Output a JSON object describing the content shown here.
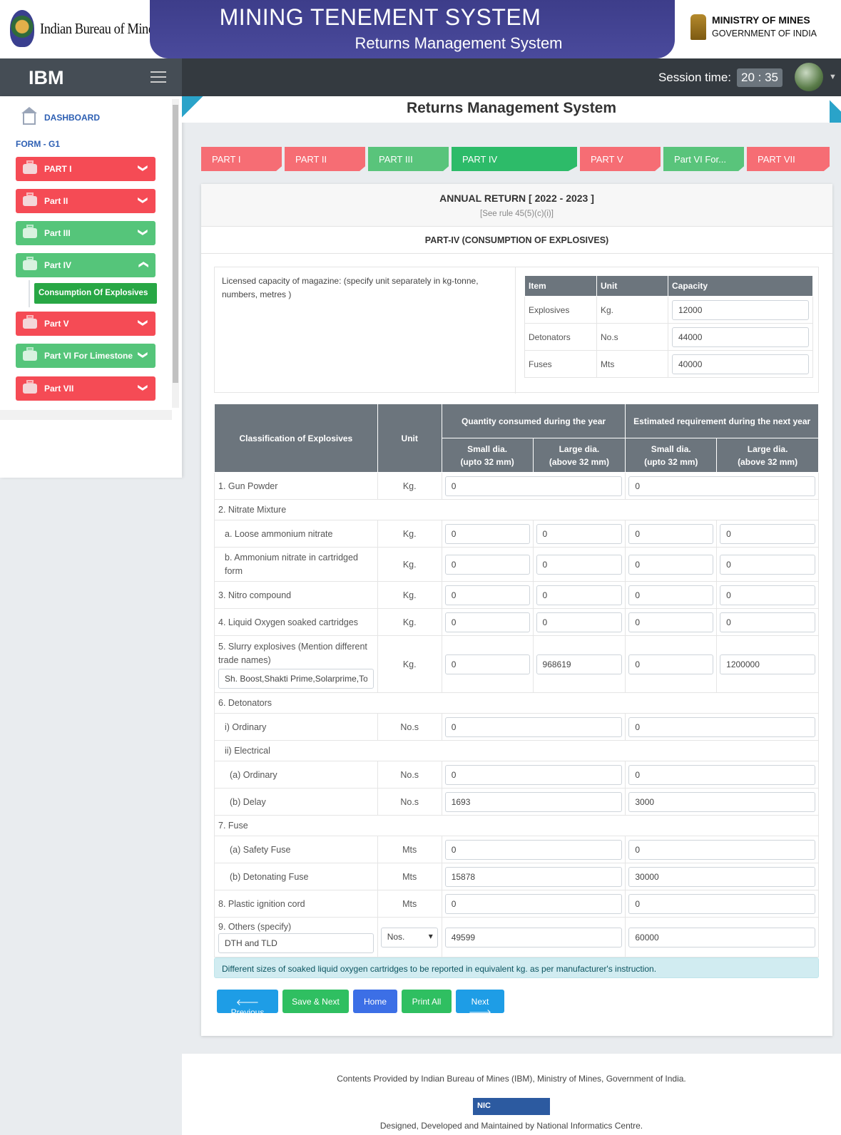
{
  "header": {
    "left_logo_text": "Indian Bureau of Mines",
    "title": "MINING TENEMENT SYSTEM",
    "subtitle": "Returns Management System",
    "ministry_line1": "MINISTRY OF MINES",
    "ministry_line2": "GOVERNMENT OF INDIA"
  },
  "navbar": {
    "brand": "IBM",
    "session_label": "Session time:",
    "session_value": "20 : 35"
  },
  "sidebar": {
    "dashboard": "DASHBOARD",
    "form_label": "FORM - G1",
    "items": [
      {
        "label": "PART I",
        "color": "#f54b55"
      },
      {
        "label": "Part II",
        "color": "#f54b55"
      },
      {
        "label": "Part III",
        "color": "#55c57a"
      },
      {
        "label": "Part IV",
        "color": "#55c57a"
      },
      {
        "label": "Part V",
        "color": "#f54b55"
      },
      {
        "label": "Part VI For Limestone",
        "color": "#55c57a"
      },
      {
        "label": "Part VII",
        "color": "#f54b55"
      }
    ],
    "sub_item": "Consumption Of Explosives"
  },
  "page_title": "Returns Management System",
  "tabs": [
    {
      "label": "PART I"
    },
    {
      "label": "PART II"
    },
    {
      "label": "PART III"
    },
    {
      "label": "PART IV"
    },
    {
      "label": "PART V"
    },
    {
      "label": "Part VI For..."
    },
    {
      "label": "PART VII"
    }
  ],
  "form": {
    "annual_return": "ANNUAL RETURN [ 2022 - 2023 ]",
    "rule": "[See rule 45(5)(c)(i)]",
    "part_title": "PART-IV (CONSUMPTION OF EXPLOSIVES)",
    "capacity_label": "Licensed capacity of magazine: (specify unit separately in kg-tonne, numbers, metres )",
    "capacity_headers": [
      "Item",
      "Unit",
      "Capacity"
    ],
    "capacity_rows": [
      {
        "item": "Explosives",
        "unit": "Kg.",
        "capacity": "12000"
      },
      {
        "item": "Detonators",
        "unit": "No.s",
        "capacity": "44000"
      },
      {
        "item": "Fuses",
        "unit": "Mts",
        "capacity": "40000"
      }
    ],
    "table_headers": {
      "classification": "Classification of Explosives",
      "unit": "Unit",
      "consumed": "Quantity consumed during the year",
      "estimated": "Estimated requirement during the next year",
      "small1": "Small dia.",
      "small2": "(upto 32 mm)",
      "large1": "Large dia.",
      "large2": "(above 32 mm)"
    },
    "rows": {
      "gun_powder": {
        "label": "1. Gun Powder",
        "unit": "Kg.",
        "consumed": "0",
        "estimated": "0"
      },
      "nitrate_mixture": "2. Nitrate Mixture",
      "loose_an": {
        "label": "a. Loose ammonium nitrate",
        "unit": "Kg.",
        "c_small": "0",
        "c_large": "0",
        "e_small": "0",
        "e_large": "0"
      },
      "an_cart": {
        "label": "b. Ammonium nitrate in cartridged form",
        "unit": "Kg.",
        "c_small": "0",
        "c_large": "0",
        "e_small": "0",
        "e_large": "0"
      },
      "nitro": {
        "label": "3. Nitro compound",
        "unit": "Kg.",
        "c_small": "0",
        "c_large": "0",
        "e_small": "0",
        "e_large": "0"
      },
      "lox": {
        "label": "4. Liquid Oxygen soaked cartridges",
        "unit": "Kg.",
        "c_small": "0",
        "c_large": "0",
        "e_small": "0",
        "e_large": "0"
      },
      "slurry": {
        "label": "5. Slurry explosives (Mention different trade names)",
        "trade": "Sh. Boost,Shakti Prime,Solarprime,To",
        "unit": "Kg.",
        "c_small": "0",
        "c_large": "968619",
        "e_small": "0",
        "e_large": "1200000"
      },
      "detonators": "6. Detonators",
      "ordinary": {
        "label": "i) Ordinary",
        "unit": "No.s",
        "consumed": "0",
        "estimated": "0"
      },
      "electrical": "ii) Electrical",
      "el_ordinary": {
        "label": "(a) Ordinary",
        "unit": "No.s",
        "consumed": "0",
        "estimated": "0"
      },
      "el_delay": {
        "label": "(b) Delay",
        "unit": "No.s",
        "consumed": "1693",
        "estimated": "3000"
      },
      "fuse": "7. Fuse",
      "safety_fuse": {
        "label": "(a) Safety Fuse",
        "unit": "Mts",
        "consumed": "0",
        "estimated": "0"
      },
      "det_fuse": {
        "label": "(b) Detonating Fuse",
        "unit": "Mts",
        "consumed": "15878",
        "estimated": "30000"
      },
      "plastic": {
        "label": "8. Plastic ignition cord",
        "unit": "Mts",
        "consumed": "0",
        "estimated": "0"
      },
      "others": {
        "label": "9. Others (specify)",
        "spec": "DTH and TLD",
        "unit": "Nos.",
        "consumed": "49599",
        "estimated": "60000"
      }
    },
    "notice": "Different sizes of soaked liquid oxygen cartridges to be reported in equivalent kg. as per manufacturer's instruction.",
    "buttons": {
      "previous": "🡐 Previous",
      "save_next": "Save & Next",
      "home": "Home",
      "print_all": "Print All",
      "next": "Next 🡒"
    }
  },
  "footer": {
    "line1": "Contents Provided by Indian Bureau of Mines (IBM), Ministry of Mines, Government of India.",
    "nic_logo": "NIC",
    "line2": "Designed, Developed and Maintained by National Informatics Centre."
  }
}
